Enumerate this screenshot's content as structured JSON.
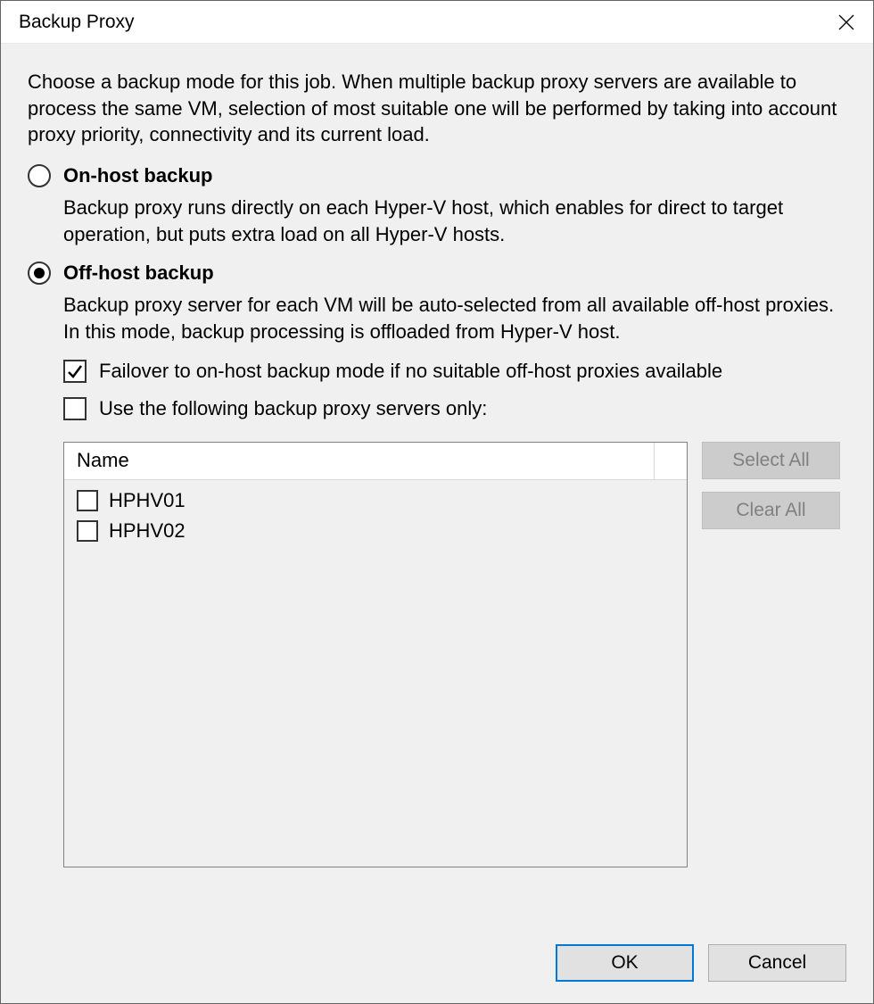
{
  "dialog": {
    "title": "Backup Proxy",
    "description": "Choose a backup mode for this job. When multiple backup proxy servers are available to process the same VM, selection of most suitable one will be performed by taking into account proxy priority, connectivity and its current load."
  },
  "options": {
    "onhost": {
      "label": "On-host backup",
      "desc": "Backup proxy runs directly on each Hyper-V host, which enables for direct to target operation, but puts extra load on all Hyper-V hosts.",
      "selected": false
    },
    "offhost": {
      "label": "Off-host backup",
      "desc": "Backup proxy server for each VM will be auto-selected from all available off­-host proxies. In this mode, backup processing is offloaded from Hyper-V host.",
      "selected": true
    }
  },
  "checkboxes": {
    "failover": {
      "label": "Failover to on-host backup mode if no suitable off-host proxies available",
      "checked": true
    },
    "useOnly": {
      "label": "Use the following backup proxy servers only:",
      "checked": false
    }
  },
  "proxyList": {
    "header": "Name",
    "items": [
      {
        "name": "HPHV01",
        "checked": false
      },
      {
        "name": "HPHV02",
        "checked": false
      }
    ]
  },
  "buttons": {
    "selectAll": "Select All",
    "clearAll": "Clear All",
    "ok": "OK",
    "cancel": "Cancel"
  }
}
